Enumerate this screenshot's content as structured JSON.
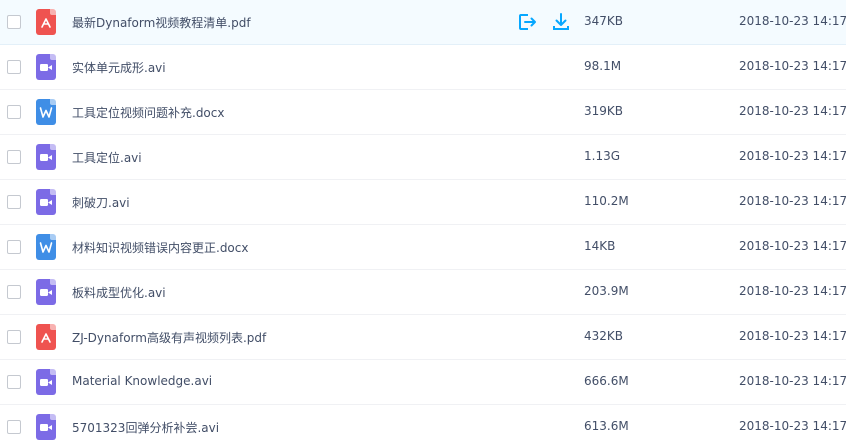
{
  "colors": {
    "pdf_icon": "#ef5350",
    "video_icon": "#7c6be6",
    "word_icon": "#3f8ee6",
    "action_icon": "#06a7ff",
    "hover_row": "#f4fbff",
    "text": "#424e67"
  },
  "files": [
    {
      "name": "最新Dynaform视频教程清单.pdf",
      "type": "pdf-icon",
      "size": "347KB",
      "modified": "2018-10-23 14:17"
    },
    {
      "name": "实体单元成形.avi",
      "type": "video-icon",
      "size": "98.1M",
      "modified": "2018-10-23 14:17"
    },
    {
      "name": "工具定位视频问题补充.docx",
      "type": "word-icon",
      "size": "319KB",
      "modified": "2018-10-23 14:17"
    },
    {
      "name": "工具定位.avi",
      "type": "video-icon",
      "size": "1.13G",
      "modified": "2018-10-23 14:17"
    },
    {
      "name": "刺破刀.avi",
      "type": "video-icon",
      "size": "110.2M",
      "modified": "2018-10-23 14:17"
    },
    {
      "name": "材料知识视频错误内容更正.docx",
      "type": "word-icon",
      "size": "14KB",
      "modified": "2018-10-23 14:17"
    },
    {
      "name": "板料成型优化.avi",
      "type": "video-icon",
      "size": "203.9M",
      "modified": "2018-10-23 14:17"
    },
    {
      "name": "ZJ-Dynaform高级有声视频列表.pdf",
      "type": "pdf-icon",
      "size": "432KB",
      "modified": "2018-10-23 14:17"
    },
    {
      "name": "Material Knowledge.avi",
      "type": "video-icon",
      "size": "666.6M",
      "modified": "2018-10-23 14:17"
    },
    {
      "name": "5701323回弹分析补尝.avi",
      "type": "video-icon",
      "size": "613.6M",
      "modified": "2018-10-23 14:17"
    }
  ],
  "hovered_row_actions": [
    "share-icon",
    "download-icon"
  ]
}
